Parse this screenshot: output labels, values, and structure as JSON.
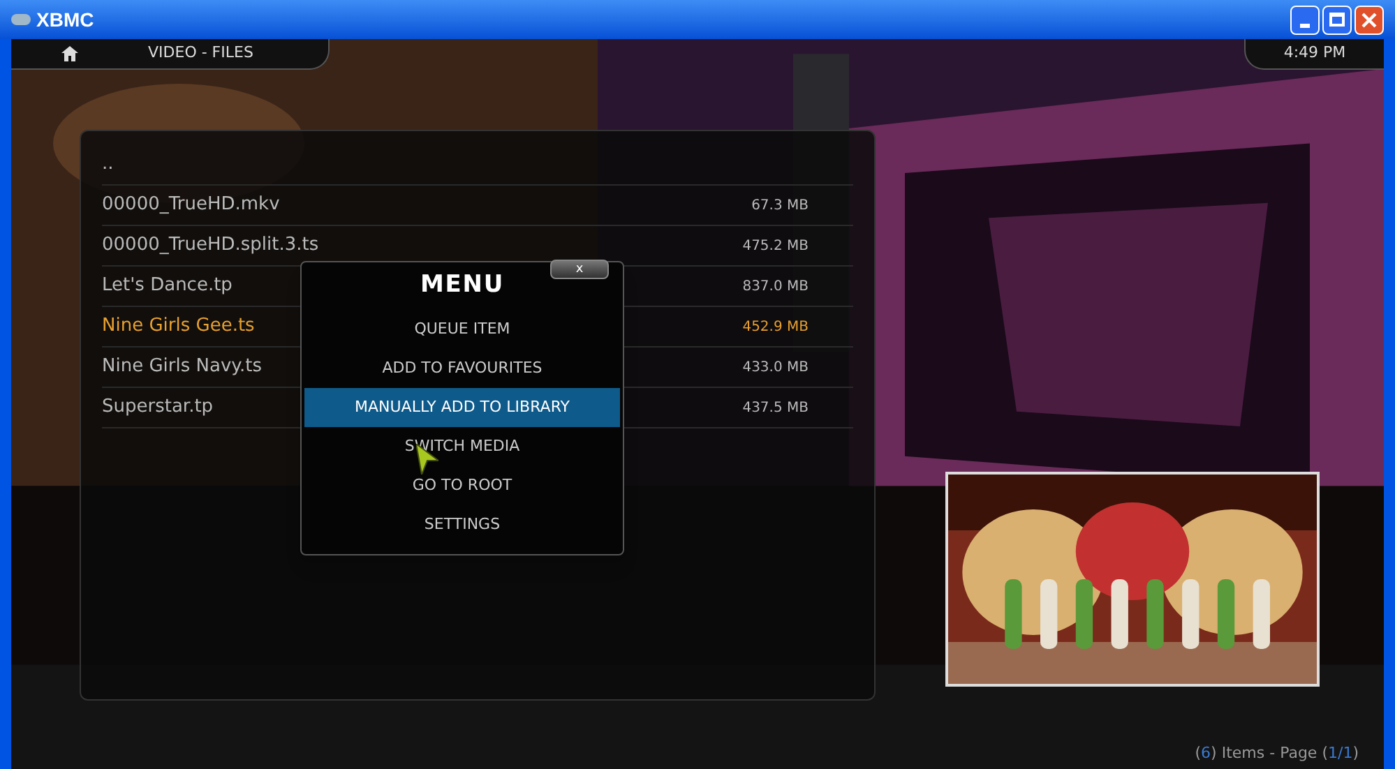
{
  "window": {
    "title": "XBMC"
  },
  "header": {
    "breadcrumb": "VIDEO - FILES",
    "clock": "4:49 PM"
  },
  "files": [
    {
      "name": "..",
      "selected": false
    },
    {
      "name": "00000_TrueHD.mkv",
      "size": "67.3 MB",
      "selected": false
    },
    {
      "name": "00000_TrueHD.split.3.ts",
      "size": "475.2 MB",
      "selected": false
    },
    {
      "name": "Let's Dance.tp",
      "size": "837.0 MB",
      "selected": false
    },
    {
      "name": "Nine Girls Gee.ts",
      "size": "452.9 MB",
      "selected": true
    },
    {
      "name": "Nine Girls Navy.ts",
      "size": "433.0 MB",
      "selected": false
    },
    {
      "name": "Superstar.tp",
      "size": "437.5 MB",
      "selected": false
    }
  ],
  "menu": {
    "title": "MENU",
    "close": "x",
    "items": [
      {
        "label": "QUEUE ITEM",
        "selected": false
      },
      {
        "label": "ADD TO FAVOURITES",
        "selected": false
      },
      {
        "label": "MANUALLY ADD TO LIBRARY",
        "selected": true
      },
      {
        "label": "SWITCH MEDIA",
        "selected": false
      },
      {
        "label": "GO TO ROOT",
        "selected": false
      },
      {
        "label": "SETTINGS",
        "selected": false
      }
    ]
  },
  "footer": [
    {
      "text": "(",
      "kind": "plain"
    },
    {
      "text": "6",
      "kind": "accent"
    },
    {
      "text": ") Items - Page (",
      "kind": "plain"
    },
    {
      "text": "1/1",
      "kind": "accent"
    },
    {
      "text": ")",
      "kind": "plain"
    }
  ]
}
